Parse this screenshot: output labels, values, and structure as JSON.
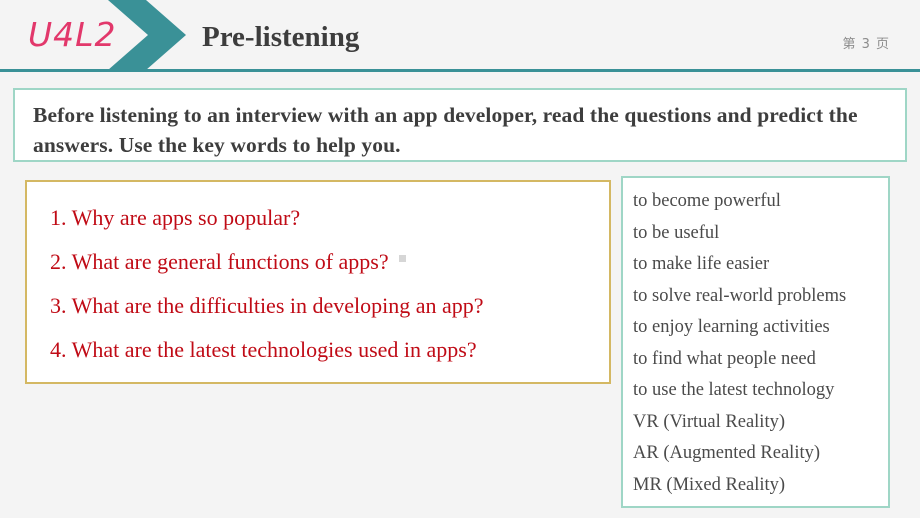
{
  "header": {
    "lesson_code": "U4L2",
    "title": "Pre-listening",
    "page_label": "第 3 页",
    "chevron_color": "#3a9197",
    "rule_color": "#3a9197",
    "lesson_code_color": "#e2386b",
    "title_color": "#3d3d3d"
  },
  "instruction": {
    "text": "Before listening to an interview with an app developer, read the questions and predict the answers. Use the key words to help you.",
    "border_color": "#9fd6c6",
    "background": "#ffffff"
  },
  "questions": {
    "border_color": "#d4b863",
    "text_color": "#c00b16",
    "items": [
      "1. Why are apps so popular?",
      "2. What are general functions of apps?",
      "3. What are the difficulties in developing an app?",
      "4. What are the latest technologies used in apps?"
    ]
  },
  "keywords": {
    "border_color": "#9fd6c6",
    "text_color": "#4a4a4a",
    "items": [
      "to become powerful",
      "to be useful",
      "to make life easier",
      "to solve real-world problems",
      "to enjoy learning activities",
      "to find what people need",
      "to use the latest technology",
      "VR (Virtual Reality)",
      "AR (Augmented Reality)",
      "MR (Mixed Reality)"
    ]
  },
  "canvas": {
    "background": "#f4f4f4"
  }
}
